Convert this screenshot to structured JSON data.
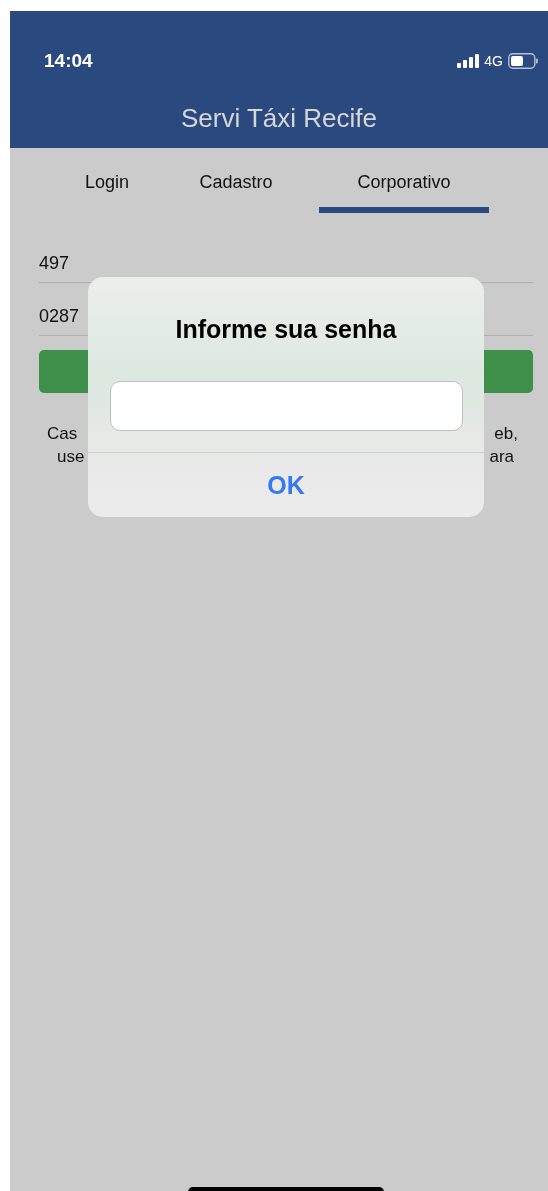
{
  "status_bar": {
    "time": "14:04",
    "network": "4G"
  },
  "header": {
    "title": "Servi Táxi Recife"
  },
  "tabs": [
    {
      "label": "Login",
      "selected": false
    },
    {
      "label": "Cadastro",
      "selected": false
    },
    {
      "label": "Corporativo",
      "selected": true
    }
  ],
  "fields": [
    {
      "value": "497"
    },
    {
      "value": "0287"
    }
  ],
  "notice_lines": [
    {
      "left": "Cas",
      "right": "eb,"
    },
    {
      "left": "use",
      "right": "ara"
    }
  ],
  "dialog": {
    "title": "Informe sua senha",
    "button": "OK"
  }
}
